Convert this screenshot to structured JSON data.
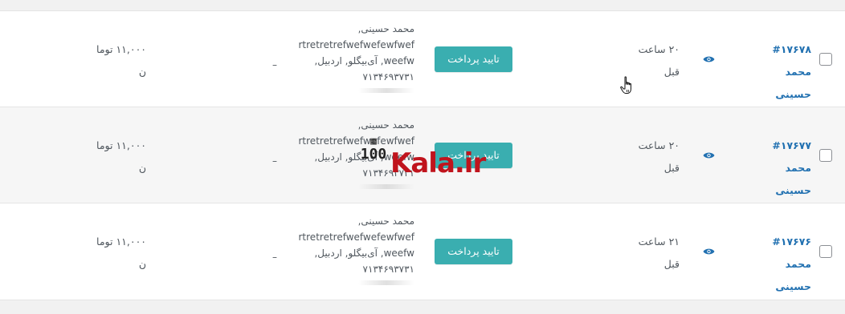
{
  "orders": [
    {
      "order_label": "#۱۷۶۷۸ محمد حسینی",
      "date_line1": "۲۰ ساعت",
      "date_line2": "قبل",
      "action_label": "تایید پرداخت",
      "address_lines": [
        "محمد حسینی,",
        "rtretretrefwefwefewfwef",
        "weefw, آی‌بیگلو, اردبیل,",
        "۷۱۳۴۶۹۳۷۳۱"
      ],
      "shipping": "–",
      "total_line1": "۱۱,۰۰۰ توما",
      "total_line2": "ن"
    },
    {
      "order_label": "#۱۷۶۷۷ محمد حسینی",
      "date_line1": "۲۰ ساعت",
      "date_line2": "قبل",
      "action_label": "تایید پرداخت",
      "address_lines": [
        "محمد حسینی,",
        "rtretretrefwefwefewfwef",
        "weefw, آی‌بیگلو, اردبیل,",
        "۷۱۳۴۶۹۳۷۳۱"
      ],
      "shipping": "–",
      "total_line1": "۱۱,۰۰۰ توما",
      "total_line2": "ن"
    },
    {
      "order_label": "#۱۷۶۷۶ محمد حسینی",
      "date_line1": "۲۱ ساعت",
      "date_line2": "قبل",
      "action_label": "تایید پرداخت",
      "address_lines": [
        "محمد حسینی,",
        "rtretretrefwefwefewfwef",
        "weefw, آی‌بیگلو, اردبیل,",
        "۷۱۳۴۶۹۳۷۳۱"
      ],
      "shipping": "–",
      "total_line1": "۱۱,۰۰۰ توما",
      "total_line2": "ن"
    }
  ],
  "watermark": {
    "brand_text": "Kala.ir",
    "badge_text": "100",
    "brand_color": "#c0141d"
  },
  "colors": {
    "link": "#2271b1",
    "button": "#3aaeb0"
  }
}
